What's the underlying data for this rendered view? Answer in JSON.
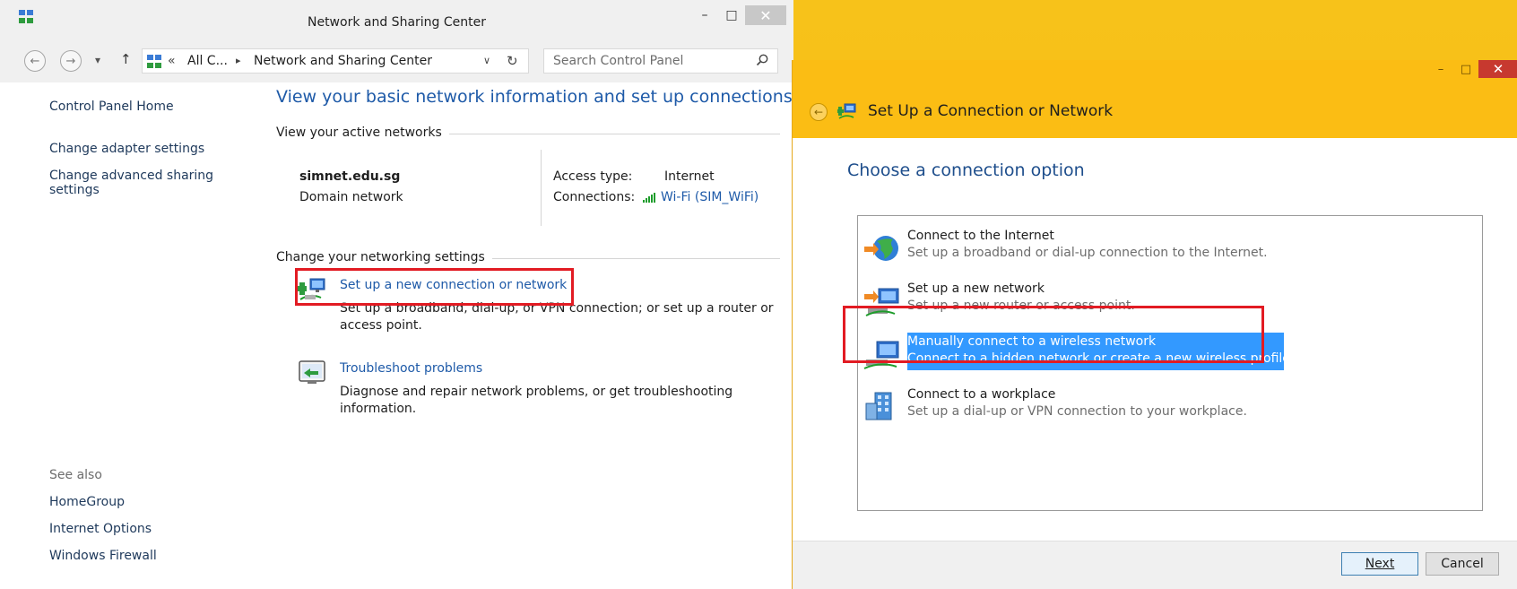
{
  "ncw": {
    "title": "Network and Sharing Center",
    "address": {
      "crumb_all": "All C...",
      "crumb_current": "Network and Sharing Center"
    },
    "search_placeholder": "Search Control Panel",
    "left_nav": {
      "home": "Control Panel Home",
      "adapter": "Change adapter settings",
      "advanced_line1": "Change advanced sharing",
      "advanced_line2": "settings"
    },
    "see_also": {
      "heading": "See also",
      "items": [
        "HomeGroup",
        "Internet Options",
        "Windows Firewall"
      ]
    },
    "main": {
      "heading": "View your basic network information and set up connections",
      "active_networks": "View your active networks",
      "network_name": "simnet.edu.sg",
      "network_type": "Domain network",
      "access_type_label": "Access type:",
      "access_type_value": "Internet",
      "connections_label": "Connections:",
      "connections_value": "Wi-Fi (SIM_WiFi)",
      "change_settings": "Change your networking settings",
      "task1_link": "Set up a new connection or network",
      "task1_desc1": "Set up a broadband, dial-up, or VPN connection; or set up a router or",
      "task1_desc2": "access point.",
      "task2_link": "Troubleshoot problems",
      "task2_desc1": "Diagnose and repair network problems, or get troubleshooting",
      "task2_desc2": "information."
    }
  },
  "wizard": {
    "title": "Set Up a Connection or Network",
    "heading": "Choose a connection option",
    "options": [
      {
        "title": "Connect to the Internet",
        "desc": "Set up a broadband or dial-up connection to the Internet."
      },
      {
        "title": "Set up a new network",
        "desc": "Set up a new router or access point."
      },
      {
        "title": "Manually connect to a wireless network",
        "desc": "Connect to a hidden network or create a new wireless profile."
      },
      {
        "title": "Connect to a workplace",
        "desc": "Set up a dial-up or VPN connection to your workplace."
      }
    ],
    "next": "Next",
    "cancel": "Cancel"
  },
  "colors": {
    "link": "#1e5aa8",
    "highlight": "#3399ff",
    "annotation_red": "#e21b23",
    "accent_yellow": "#fbbd14"
  },
  "icons": [
    "back-arrow-icon",
    "forward-arrow-icon",
    "up-arrow-icon",
    "refresh-icon",
    "search-icon",
    "network-icon",
    "wifi-signal-icon",
    "troubleshoot-icon",
    "globe-icon",
    "router-icon",
    "wireless-icon",
    "workplace-icon"
  ]
}
